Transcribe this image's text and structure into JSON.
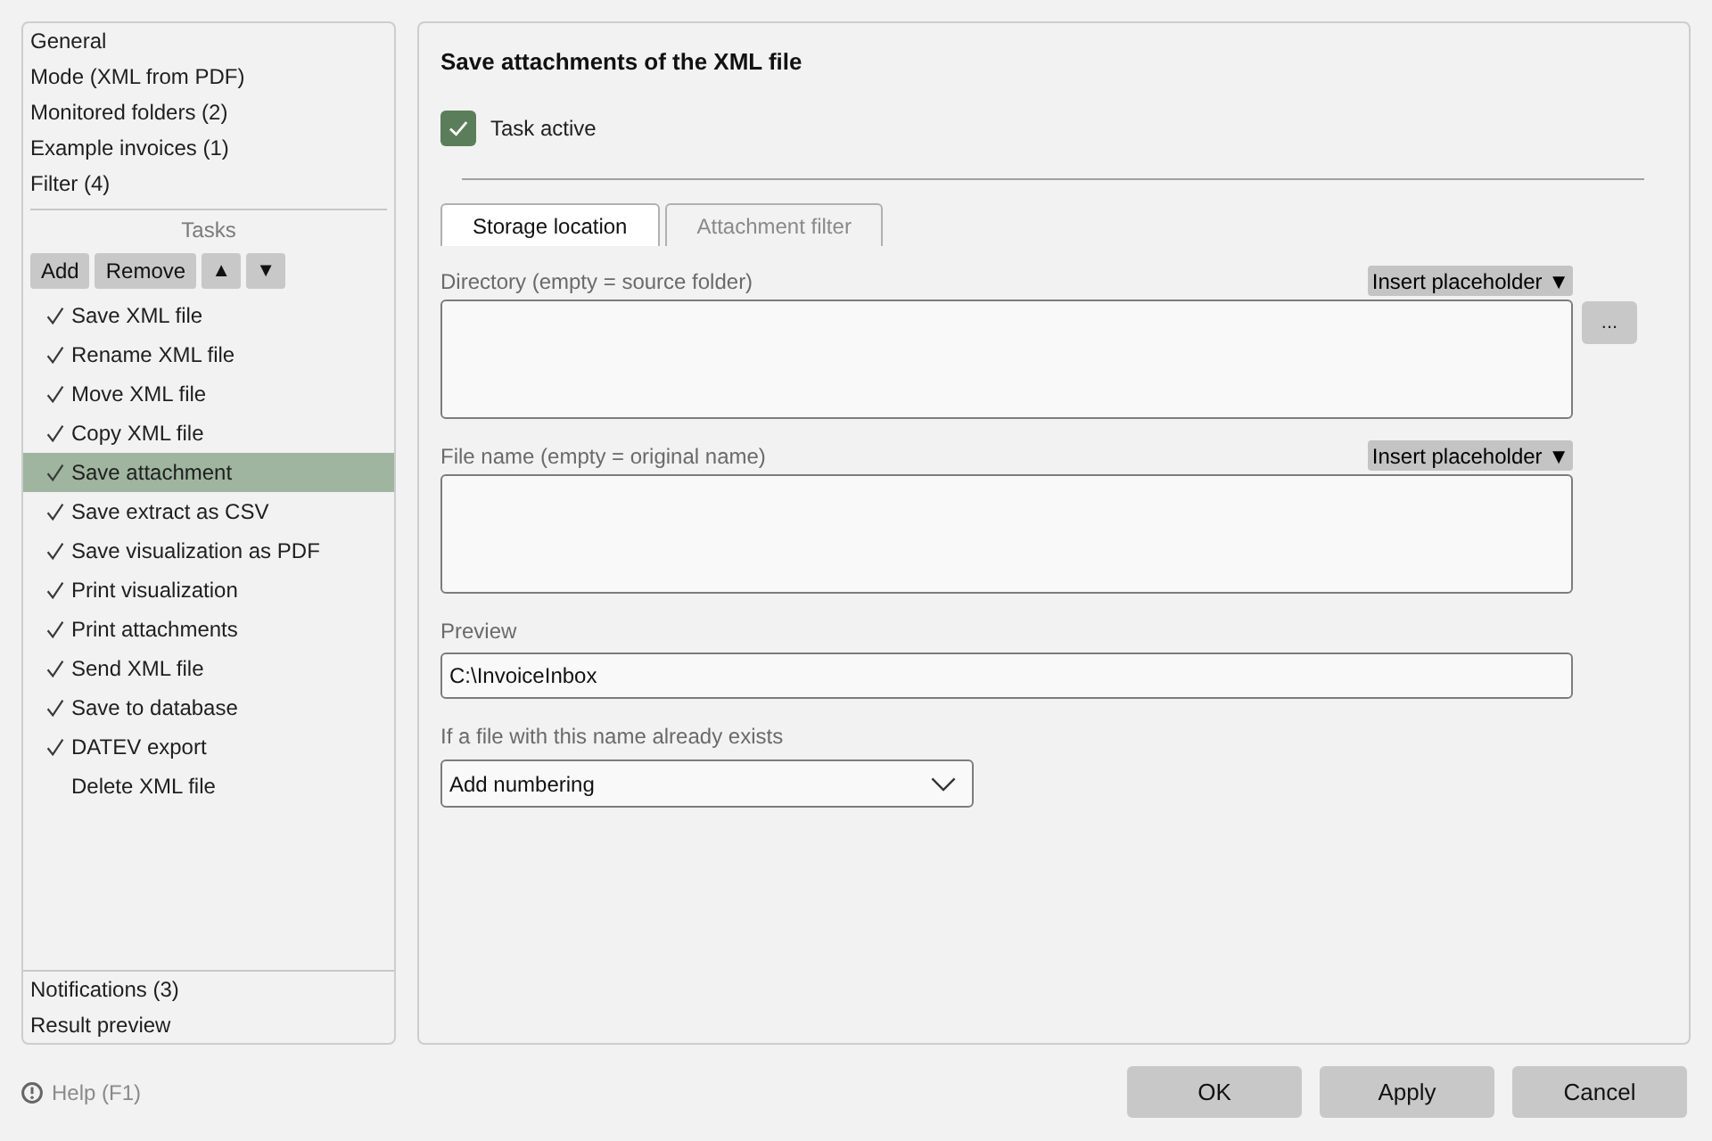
{
  "sidebar": {
    "sections": [
      {
        "label": "General",
        "selected": false
      },
      {
        "label": "Mode (XML from PDF)",
        "selected": false
      },
      {
        "label": "Monitored folders (2)",
        "selected": false
      },
      {
        "label": "Example invoices (1)",
        "selected": false
      },
      {
        "label": "Filter (4)",
        "selected": false
      }
    ],
    "tasks_heading": "Tasks",
    "task_buttons": [
      {
        "kind": "text",
        "label": "Add"
      },
      {
        "kind": "text",
        "label": "Remove"
      },
      {
        "kind": "arrow",
        "label": "▲"
      },
      {
        "kind": "arrow",
        "label": "▼"
      }
    ],
    "tasks": [
      {
        "label": "Save XML file",
        "checked": true,
        "selected": false
      },
      {
        "label": "Rename XML file",
        "checked": true,
        "selected": false
      },
      {
        "label": "Move XML file",
        "checked": true,
        "selected": false
      },
      {
        "label": "Copy XML file",
        "checked": true,
        "selected": false
      },
      {
        "label": "Save attachment",
        "checked": true,
        "selected": true
      },
      {
        "label": "Save extract as CSV",
        "checked": true,
        "selected": false
      },
      {
        "label": "Save visualization as PDF",
        "checked": true,
        "selected": false
      },
      {
        "label": "Print visualization",
        "checked": true,
        "selected": false
      },
      {
        "label": "Print attachments",
        "checked": true,
        "selected": false
      },
      {
        "label": "Send XML file",
        "checked": true,
        "selected": false
      },
      {
        "label": "Save to database",
        "checked": true,
        "selected": false
      },
      {
        "label": "DATEV export",
        "checked": true,
        "selected": false
      },
      {
        "label": "Delete XML file",
        "checked": false,
        "selected": false
      }
    ],
    "footer_items": [
      {
        "label": "Notifications (3)",
        "selected": false
      },
      {
        "label": "Result preview",
        "selected": false
      }
    ]
  },
  "help": {
    "label": "Help (F1)"
  },
  "panel": {
    "title": "Save attachments of the XML file",
    "task_active": {
      "label": "Task active",
      "checked": true
    },
    "tabs": [
      {
        "label": "Storage location",
        "selected": true
      },
      {
        "label": "Attachment filter",
        "selected": false
      }
    ],
    "fields": [
      {
        "kind": "textarea",
        "label": "Directory (empty = source folder)",
        "insert_button": "Insert placeholder ▼",
        "browse_button": "..."
      },
      {
        "kind": "textarea",
        "label": "File name (empty = original name)",
        "insert_button": "Insert placeholder ▼"
      },
      {
        "kind": "text",
        "label": "Preview",
        "value": "C:\\InvoiceInbox"
      },
      {
        "kind": "select",
        "label": "If a file with this name already exists",
        "value": "Add numbering"
      }
    ]
  },
  "buttons": [
    {
      "label": "OK"
    },
    {
      "label": "Apply"
    },
    {
      "label": "Cancel"
    }
  ]
}
